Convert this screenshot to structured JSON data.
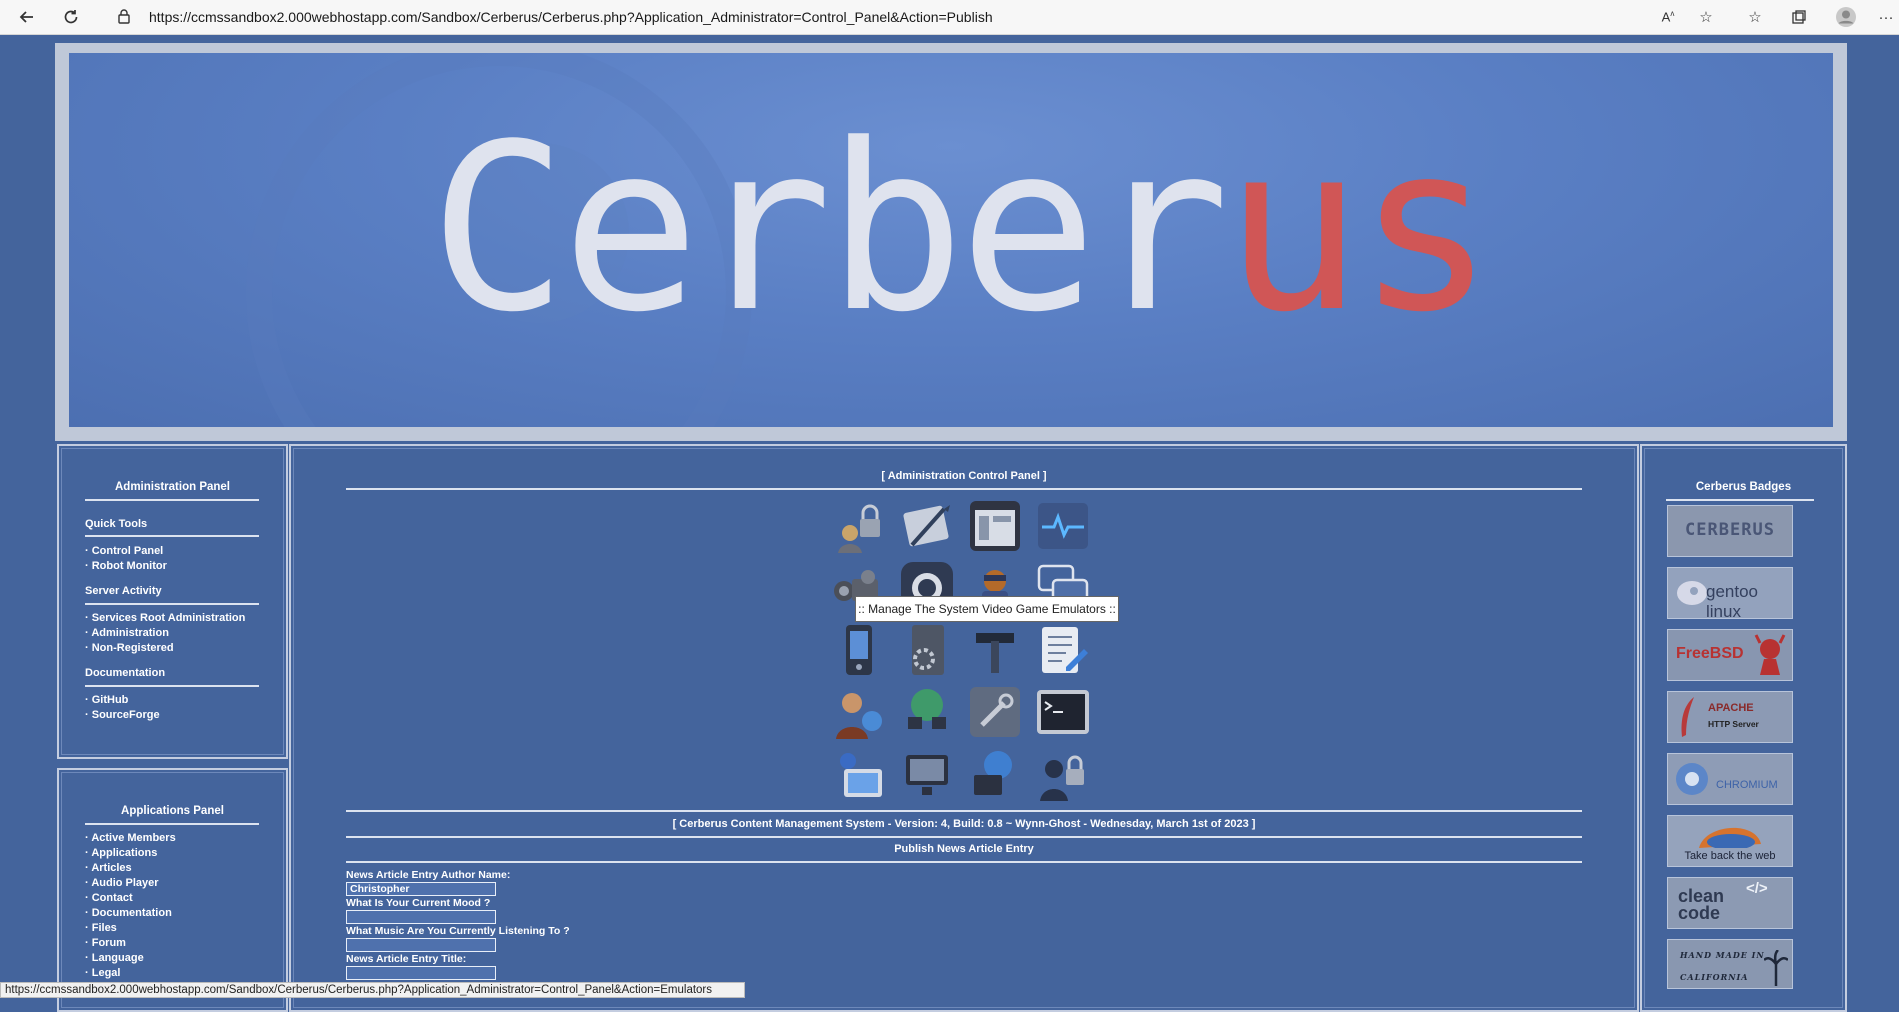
{
  "browser": {
    "url": "https://ccmssandbox2.000webhostapp.com/Sandbox/Cerberus/Cerberus.php?Application_Administrator=Control_Panel&Action=Publish",
    "icons": [
      "back-icon",
      "refresh-icon",
      "lock-icon",
      "read-aloud-icon",
      "add-favorite-icon",
      "favorites-icon",
      "collections-icon",
      "profile-icon",
      "more-icon"
    ]
  },
  "banner": {
    "logo_text": "Cerberus",
    "logo_white": "Cerber",
    "logo_red": "us"
  },
  "admin_panel": {
    "title": "Administration Panel",
    "sections": [
      {
        "heading": "Quick Tools",
        "links": [
          "Control Panel",
          "Robot Monitor"
        ]
      },
      {
        "heading": "Server Activity",
        "links": [
          "Services Root Administration",
          "Administration",
          "Non-Registered"
        ]
      },
      {
        "heading": "Documentation",
        "links": [
          "GitHub",
          "SourceForge"
        ]
      }
    ]
  },
  "apps_panel": {
    "title": "Applications Panel",
    "links": [
      "Active Members",
      "Applications",
      "Articles",
      "Audio Player",
      "Contact",
      "Documentation",
      "Files",
      "Forum",
      "Language",
      "Legal"
    ]
  },
  "center": {
    "title": "[ Administration Control Panel ]",
    "icons": [
      "padlock-users-icon",
      "quill-pen-icon",
      "window-app-icon",
      "heartbeat-monitor-icon",
      "video-camera-icon",
      "github-icon",
      "robot-mascot-icon",
      "chat-bubbles-icon",
      "mobile-device-icon",
      "server-gear-icon",
      "tools-icon",
      "document-edit-icon",
      "user-globe-icon",
      "network-globe-icon",
      "wrench-icon",
      "terminal-icon",
      "user-computer-icon",
      "monitor-icon",
      "globe-computer-icon",
      "user-lock-icon"
    ],
    "version_line": "[ Cerberus Content Management System - Version: 4, Build: 0.8 ~ Wynn-Ghost - Wednesday, March 1st of 2023 ]",
    "publish_title": "Publish News Article Entry",
    "form": {
      "author_label": "News Article Entry Author Name:",
      "author_value": "Christopher",
      "mood_label": "What Is Your Current Mood ?",
      "mood_value": "",
      "music_label": "What Music Are You Currently Listening To ?",
      "music_value": "",
      "title_label": "News Article Entry Title:",
      "title_value": ""
    }
  },
  "tooltip": ":: Manage The System Video Game Emulators ::",
  "badges_panel": {
    "title": "Cerberus Badges",
    "badges": [
      {
        "label": "CERBERUS"
      },
      {
        "label": "gentoo linux"
      },
      {
        "label": "FreeBSD"
      },
      {
        "label": "APACHE",
        "sub": "HTTP Server"
      },
      {
        "label": "CHROMIUM"
      },
      {
        "label": "Take back the web"
      },
      {
        "label": "clean code"
      },
      {
        "label": "HAND MADE IN",
        "sub": "CALIFORNIA"
      }
    ]
  },
  "statusbar": "https://ccmssandbox2.000webhostapp.com/Sandbox/Cerberus/Cerberus.php?Application_Administrator=Control_Panel&Action=Emulators",
  "colors": {
    "page_bg": "#44649c",
    "logo_red": "#d05656",
    "logo_white": "#dfe3ee"
  }
}
